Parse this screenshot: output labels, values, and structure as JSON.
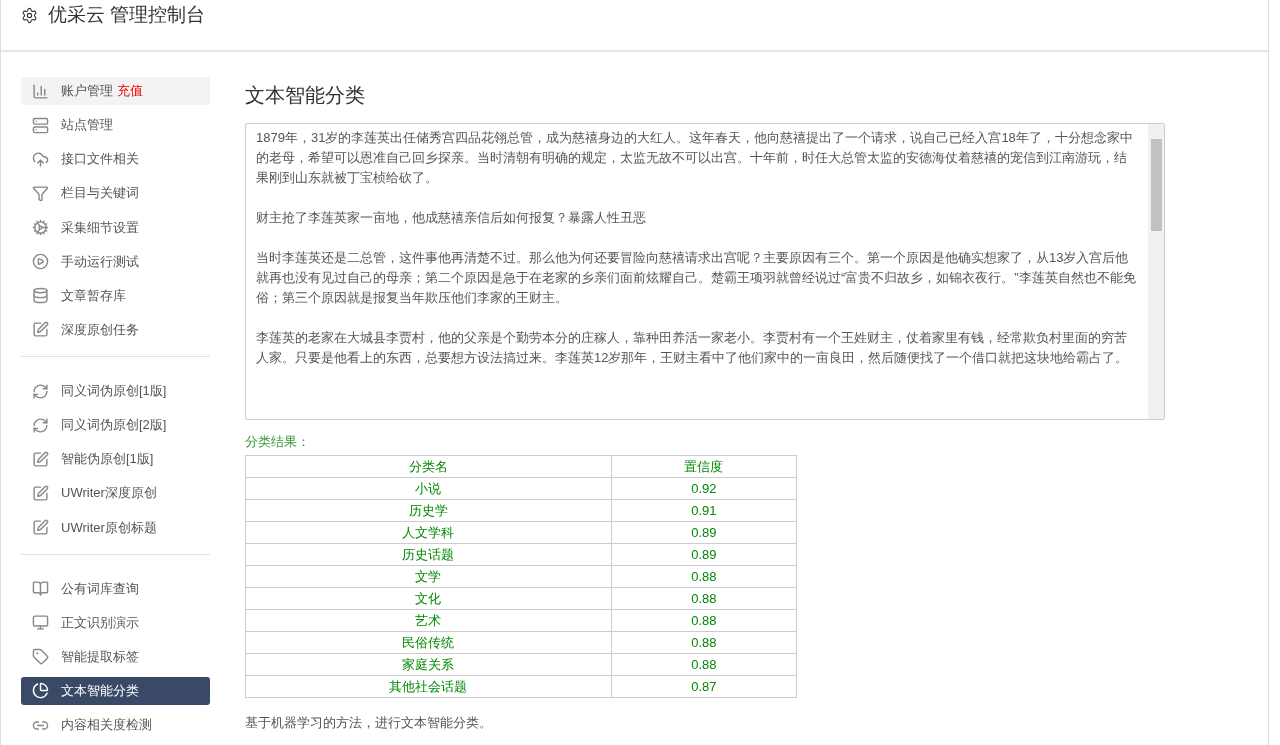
{
  "header": {
    "title": "优采云 管理控制台"
  },
  "sidebar": {
    "groups": [
      {
        "items": [
          {
            "label": "账户管理",
            "badge": "充值",
            "selected": false
          },
          {
            "label": "站点管理",
            "selected": false
          },
          {
            "label": "接口文件相关",
            "selected": false
          },
          {
            "label": "栏目与关键词",
            "selected": false
          },
          {
            "label": "采集细节设置",
            "selected": false
          },
          {
            "label": "手动运行测试",
            "selected": false
          },
          {
            "label": "文章暂存库",
            "selected": false
          },
          {
            "label": "深度原创任务",
            "selected": false
          }
        ]
      },
      {
        "items": [
          {
            "label": "同义词伪原创[1版]",
            "selected": false
          },
          {
            "label": "同义词伪原创[2版]",
            "selected": false
          },
          {
            "label": "智能伪原创[1版]",
            "selected": false
          },
          {
            "label": "UWriter深度原创",
            "selected": false
          },
          {
            "label": "UWriter原创标题",
            "selected": false
          }
        ]
      },
      {
        "items": [
          {
            "label": "公有词库查询",
            "selected": false
          },
          {
            "label": "正文识别演示",
            "selected": false
          },
          {
            "label": "智能提取标签",
            "selected": false
          },
          {
            "label": "文本智能分类",
            "selected": true
          },
          {
            "label": "内容相关度检测",
            "selected": false
          }
        ]
      }
    ]
  },
  "main": {
    "title": "文本智能分类",
    "text_input": {
      "paragraphs": [
        "1879年，31岁的李莲英出任储秀宫四品花翎总管，成为慈禧身边的大红人。这年春天，他向慈禧提出了一个请求，说自己已经入宫18年了，十分想念家中的老母，希望可以恩准自己回乡探亲。当时清朝有明确的规定，太监无故不可以出宫。十年前，时任大总管太监的安德海仗着慈禧的宠信到江南游玩，结果刚到山东就被丁宝桢给砍了。",
        "财主抢了李莲英家一亩地，他成慈禧亲信后如何报复？暴露人性丑恶",
        "当时李莲英还是二总管，这件事他再清楚不过。那么他为何还要冒险向慈禧请求出宫呢？主要原因有三个。第一个原因是他确实想家了，从13岁入宫后他就再也没有见过自己的母亲；第二个原因是急于在老家的乡亲们面前炫耀自己。楚霸王项羽就曾经说过“富贵不归故乡，如锦衣夜行。”李莲英自然也不能免俗；第三个原因就是报复当年欺压他们李家的王财主。",
        "李莲英的老家在大城县李贾村，他的父亲是个勤劳本分的庄稼人，靠种田养活一家老小。李贾村有一个王姓财主，仗着家里有钱，经常欺负村里面的穷苦人家。只要是他看上的东西，总要想方设法搞过来。李莲英12岁那年，王财主看中了他们家中的一亩良田，然后随便找了一个借口就把这块地给霸占了。"
      ]
    },
    "result_label": "分类结果：",
    "table": {
      "columns": [
        "分类名",
        "置信度"
      ],
      "rows": [
        [
          "小说",
          "0.92"
        ],
        [
          "历史学",
          "0.91"
        ],
        [
          "人文学科",
          "0.89"
        ],
        [
          "历史话题",
          "0.89"
        ],
        [
          "文学",
          "0.88"
        ],
        [
          "文化",
          "0.88"
        ],
        [
          "艺术",
          "0.88"
        ],
        [
          "民俗传统",
          "0.88"
        ],
        [
          "家庭关系",
          "0.88"
        ],
        [
          "其他社会话题",
          "0.87"
        ]
      ]
    },
    "footnote": "基于机器学习的方法，进行文本智能分类。"
  }
}
